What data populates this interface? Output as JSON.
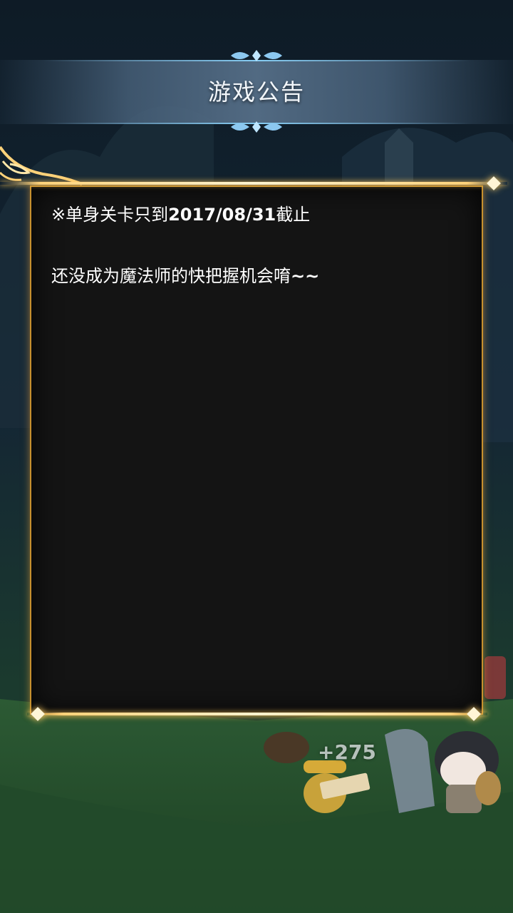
{
  "dialog": {
    "title": "游戏公告",
    "lines": [
      {
        "prefix": "※单身关卡只到",
        "bold": "2017/08/31",
        "suffix": "截止"
      },
      {
        "prefix": "还没成为魔法师的快把握机会唷",
        "bold": "~~",
        "suffix": ""
      }
    ]
  },
  "game": {
    "score_popup": "+275"
  },
  "colors": {
    "panel_border": "#c7902e",
    "rail_glow": "#ffd27a",
    "banner": "#55708a",
    "panel_bg": "#141414"
  }
}
